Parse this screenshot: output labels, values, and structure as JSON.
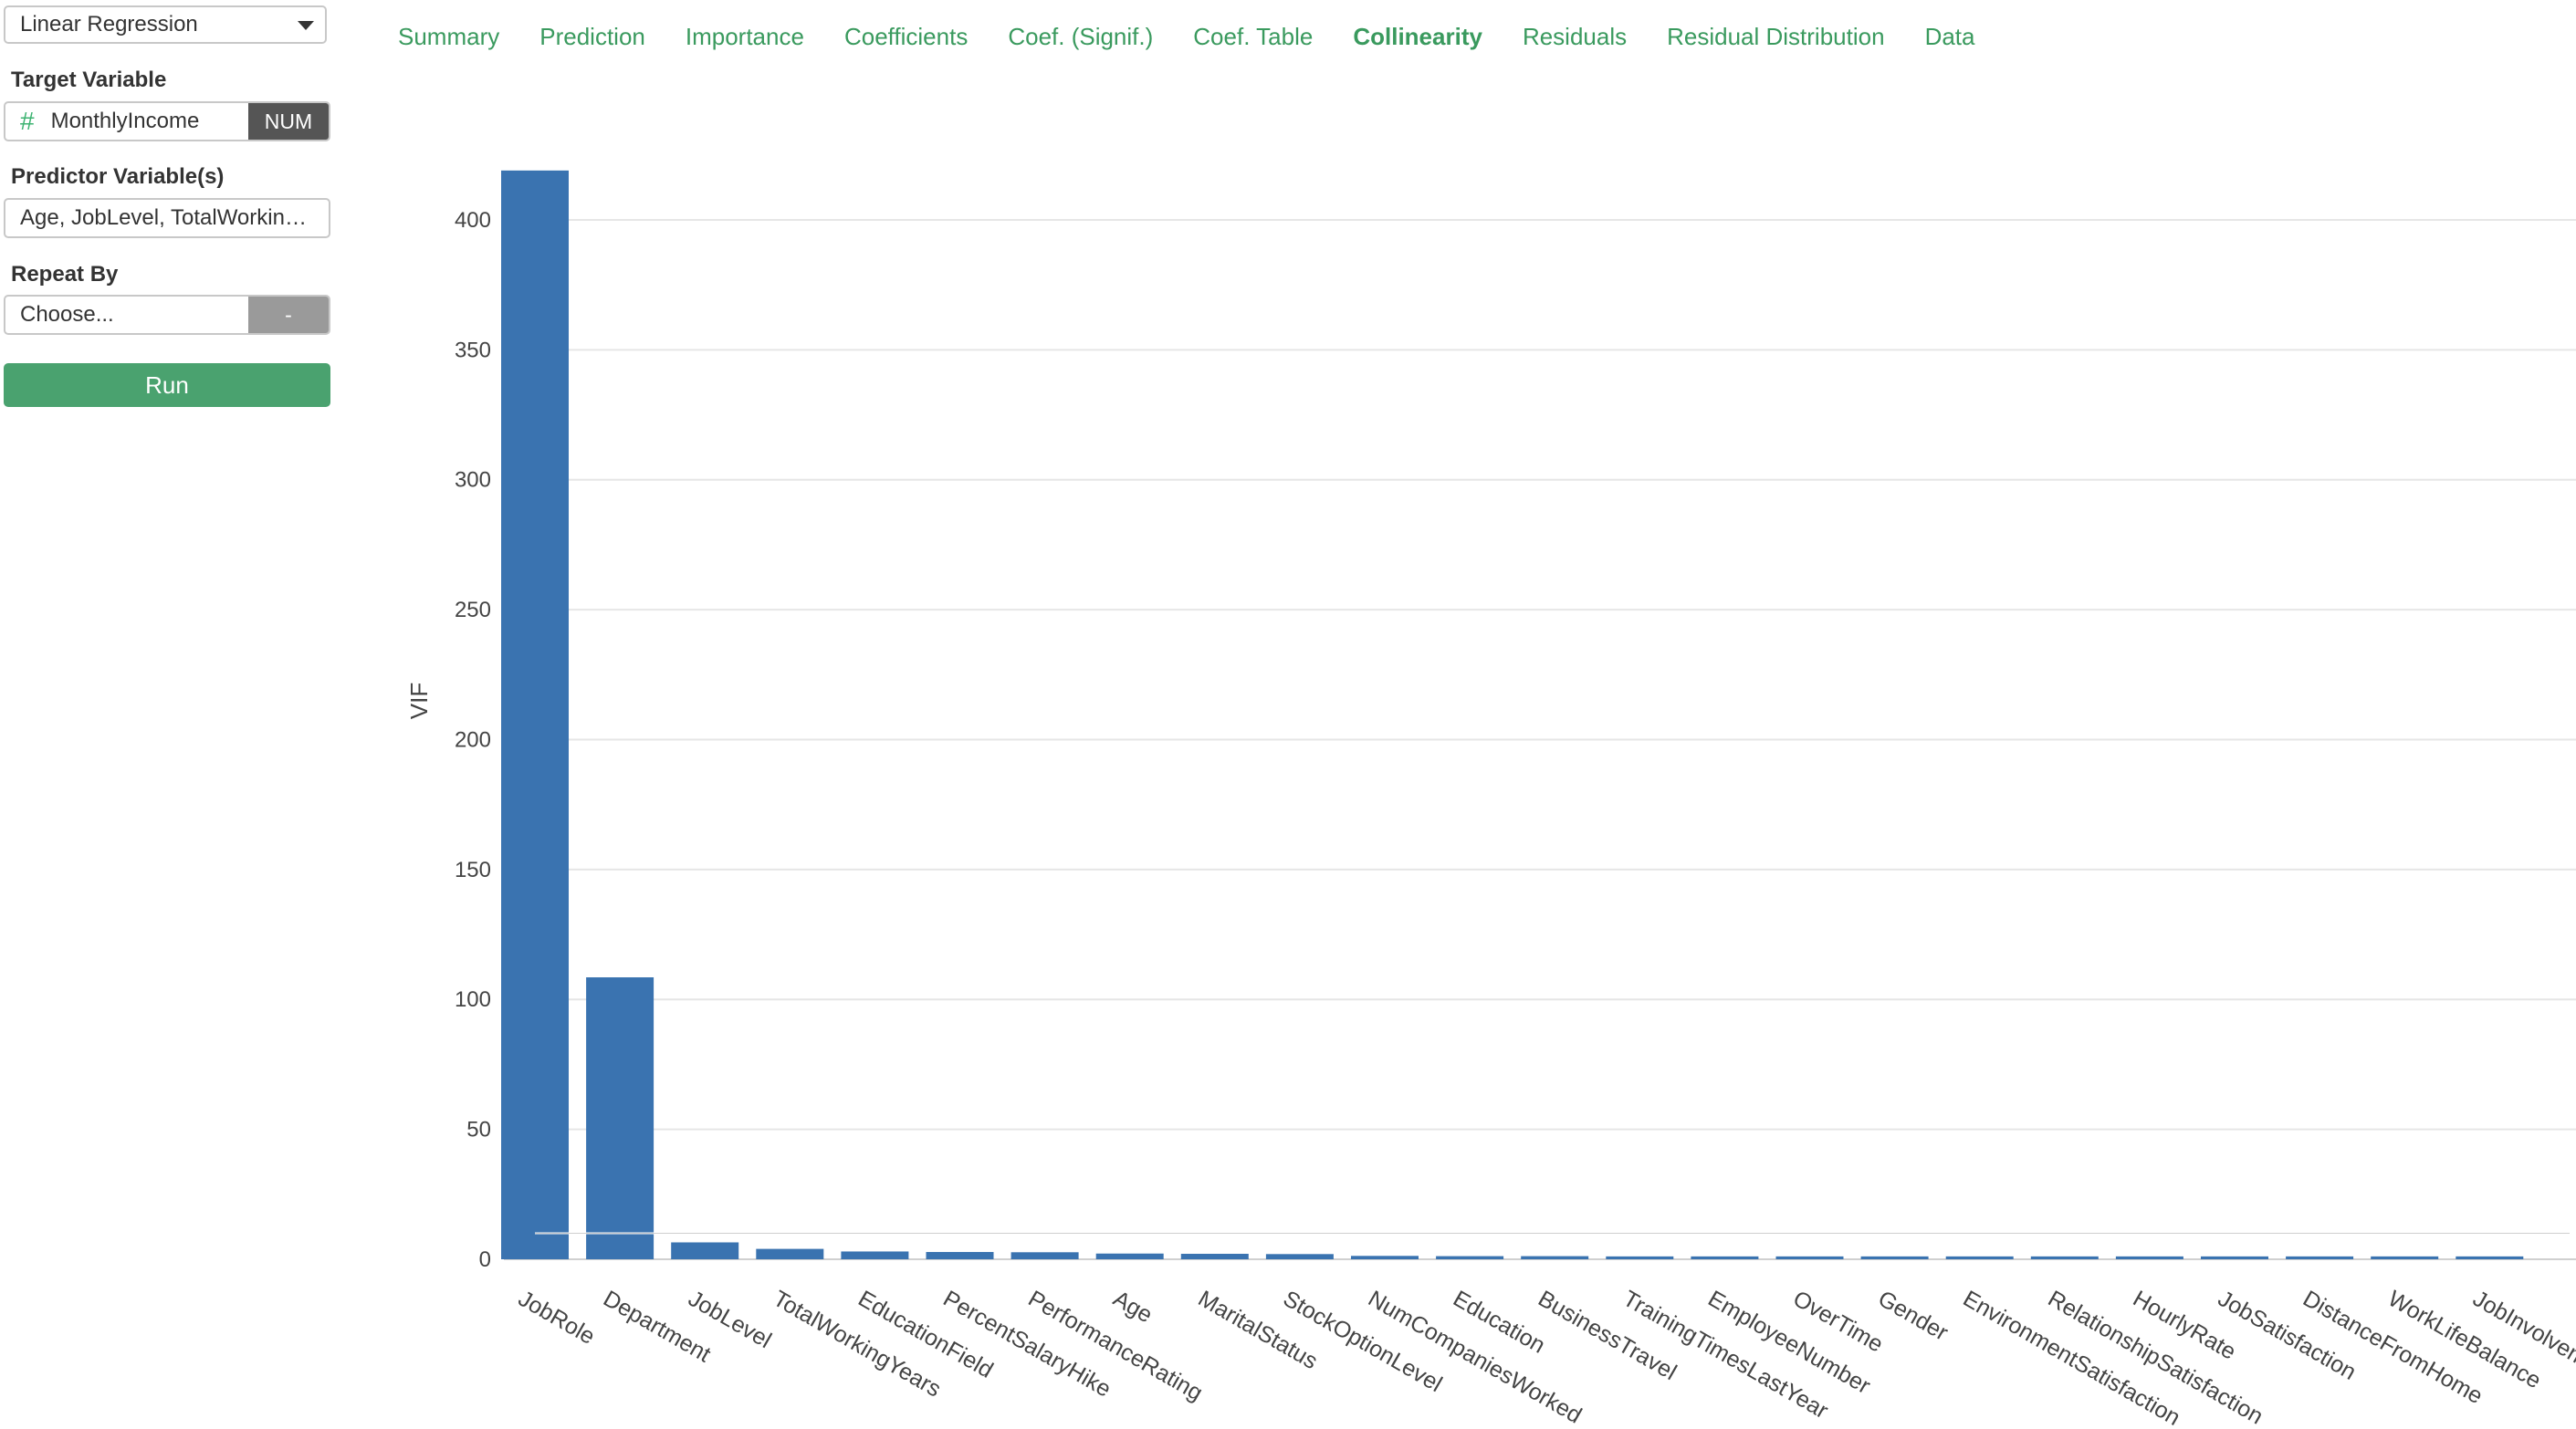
{
  "sidebar": {
    "model_select": "Linear Regression",
    "target_label": "Target Variable",
    "target_value": "MonthlyIncome",
    "target_type": "NUM",
    "predictor_label": "Predictor Variable(s)",
    "predictor_value": "Age, JobLevel, TotalWorkin…",
    "repeat_label": "Repeat By",
    "repeat_value": "Choose...",
    "repeat_tag": "-",
    "run_label": "Run"
  },
  "tabs": [
    {
      "label": "Summary",
      "active": false
    },
    {
      "label": "Prediction",
      "active": false
    },
    {
      "label": "Importance",
      "active": false
    },
    {
      "label": "Coefficients",
      "active": false
    },
    {
      "label": "Coef. (Signif.)",
      "active": false
    },
    {
      "label": "Coef. Table",
      "active": false
    },
    {
      "label": "Collinearity",
      "active": true
    },
    {
      "label": "Residuals",
      "active": false
    },
    {
      "label": "Residual Distribution",
      "active": false
    },
    {
      "label": "Data",
      "active": false
    }
  ],
  "colors": {
    "accent": "#3a9a5e",
    "run_button": "#4aa26f",
    "bar": "#3a73b0",
    "grid": "#e6e6e6"
  },
  "chart_data": {
    "type": "bar",
    "ylabel": "VIF",
    "xlabel": "",
    "ylim": [
      0,
      420
    ],
    "yticks": [
      0,
      50,
      100,
      150,
      200,
      250,
      300,
      350,
      400
    ],
    "threshold_line": 10,
    "grid": true,
    "categories": [
      "JobRole",
      "Department",
      "JobLevel",
      "TotalWorkingYears",
      "EducationField",
      "PercentSalaryHike",
      "PerformanceRating",
      "Age",
      "MaritalStatus",
      "StockOptionLevel",
      "NumCompaniesWorked",
      "Education",
      "BusinessTravel",
      "TrainingTimesLastYear",
      "EmployeeNumber",
      "OverTime",
      "Gender",
      "EnvironmentSatisfaction",
      "RelationshipSatisfaction",
      "HourlyRate",
      "JobSatisfaction",
      "DistanceFromHome",
      "WorkLifeBalance",
      "JobInvolvement"
    ],
    "values": [
      419,
      108.5,
      6.5,
      4,
      3,
      2.8,
      2.7,
      2.2,
      2.1,
      2.0,
      1.3,
      1.2,
      1.2,
      1.1,
      1.1,
      1.1,
      1.1,
      1.1,
      1.1,
      1.1,
      1.1,
      1.1,
      1.1,
      1.1
    ]
  }
}
